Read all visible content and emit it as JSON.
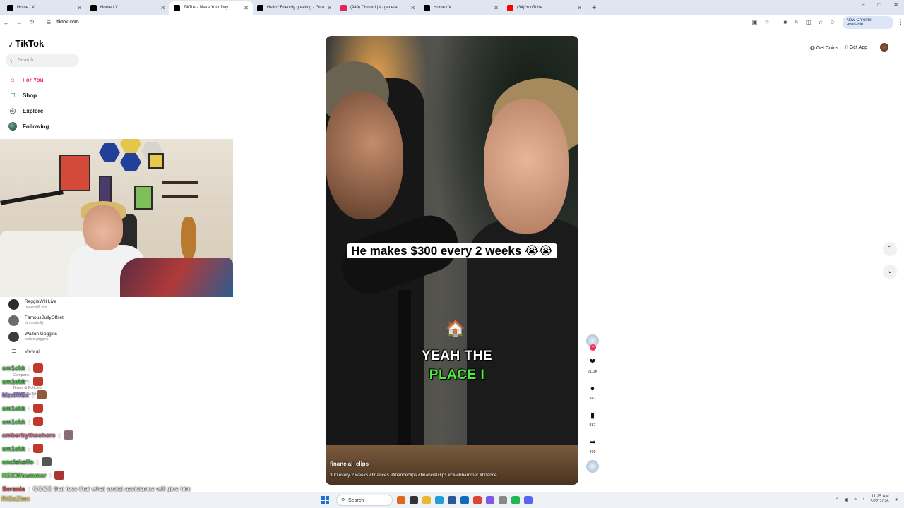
{
  "browser": {
    "tabs": [
      {
        "label": "Home / X",
        "icon": "x-logo-icon",
        "color": "#000000",
        "active": false
      },
      {
        "label": "Home / X",
        "icon": "x-logo-icon",
        "color": "#000000",
        "active": false
      },
      {
        "label": "TikTok - Make Your Day",
        "icon": "tiktok-icon",
        "color": "#000000",
        "active": true
      },
      {
        "label": "Hello? Friendly greeting - Grok",
        "icon": "grok-icon",
        "color": "#000000",
        "active": false
      },
      {
        "label": "(949) Discord | #· general |",
        "icon": "discord-icon",
        "color": "#e0245e",
        "active": false
      },
      {
        "label": "Home / X",
        "icon": "x-logo-icon",
        "color": "#000000",
        "active": false
      },
      {
        "label": "(34) YouTube",
        "icon": "youtube-icon",
        "color": "#ff0000",
        "active": false
      }
    ],
    "new_tab": "+",
    "url": "tiktok.com",
    "update_pill": "New Chrome available",
    "window_controls": [
      "–",
      "□",
      "✕"
    ]
  },
  "tiktok": {
    "logo": "TikTok",
    "search_placeholder": "Search",
    "nav": [
      {
        "label": "For You",
        "icon": "home-icon",
        "active": true
      },
      {
        "label": "Shop",
        "icon": "shopping-bag-icon",
        "active": false
      },
      {
        "label": "Explore",
        "icon": "compass-icon",
        "active": false
      },
      {
        "label": "Following",
        "icon": "following-avatar-icon",
        "active": false
      }
    ],
    "accounts": [
      {
        "name": "ReggieWill Live",
        "handle": "reggiewill_live"
      },
      {
        "name": "FamousBullyOffset",
        "handle": "famousbully"
      },
      {
        "name": "Walton Goggins",
        "handle": "walton.goggins"
      }
    ],
    "view_all": "View all",
    "footer": [
      "Company",
      "Program",
      "Terms & Policies",
      "© 2026 TikTok"
    ],
    "top_right": {
      "get_coins": "Get Coins",
      "get_app": "Get App"
    },
    "accent": "#fe2c55"
  },
  "video": {
    "caption_top": "He makes $300 every 2 weeks 😭😭",
    "caption_line1": "YEAH THE",
    "caption_line2": "PLACE I",
    "author": "financial_clips_",
    "description": "300 every 2 weeks #finances #financeclips #financialclips #calebhammer #finance",
    "likes": "21.1K",
    "comments": "341",
    "saves": "887",
    "shares": "409"
  },
  "chat": [
    {
      "user": "sm1ckk",
      "color": "#3ec33e",
      "msg": ""
    },
    {
      "user": "sm1ckk",
      "color": "#3ec33e",
      "msg": ""
    },
    {
      "user": "MzxRiGx",
      "color": "#9b7bd9",
      "msg": ""
    },
    {
      "user": "sm1ckk",
      "color": "#3ec33e",
      "msg": ""
    },
    {
      "user": "sm1ckk",
      "color": "#3ec33e",
      "msg": ""
    },
    {
      "user": "amberbytheshore",
      "color": "#d36b8c",
      "msg": ""
    },
    {
      "user": "sm1ckk",
      "color": "#3ec33e",
      "msg": ""
    },
    {
      "user": "unclekeifo",
      "color": "#3ec33e",
      "msg": ""
    },
    {
      "user": "KEKWsummer",
      "color": "#5bd14a",
      "msg": ""
    },
    {
      "user": "Serania",
      "color": "#d94a4a",
      "msg": "GGGS that less that what social assistance will give him"
    }
  ],
  "taskbar": {
    "search": "Search",
    "time": "11:25 AM",
    "date": "3/27/2026",
    "left_chat": "RiGxZion"
  }
}
